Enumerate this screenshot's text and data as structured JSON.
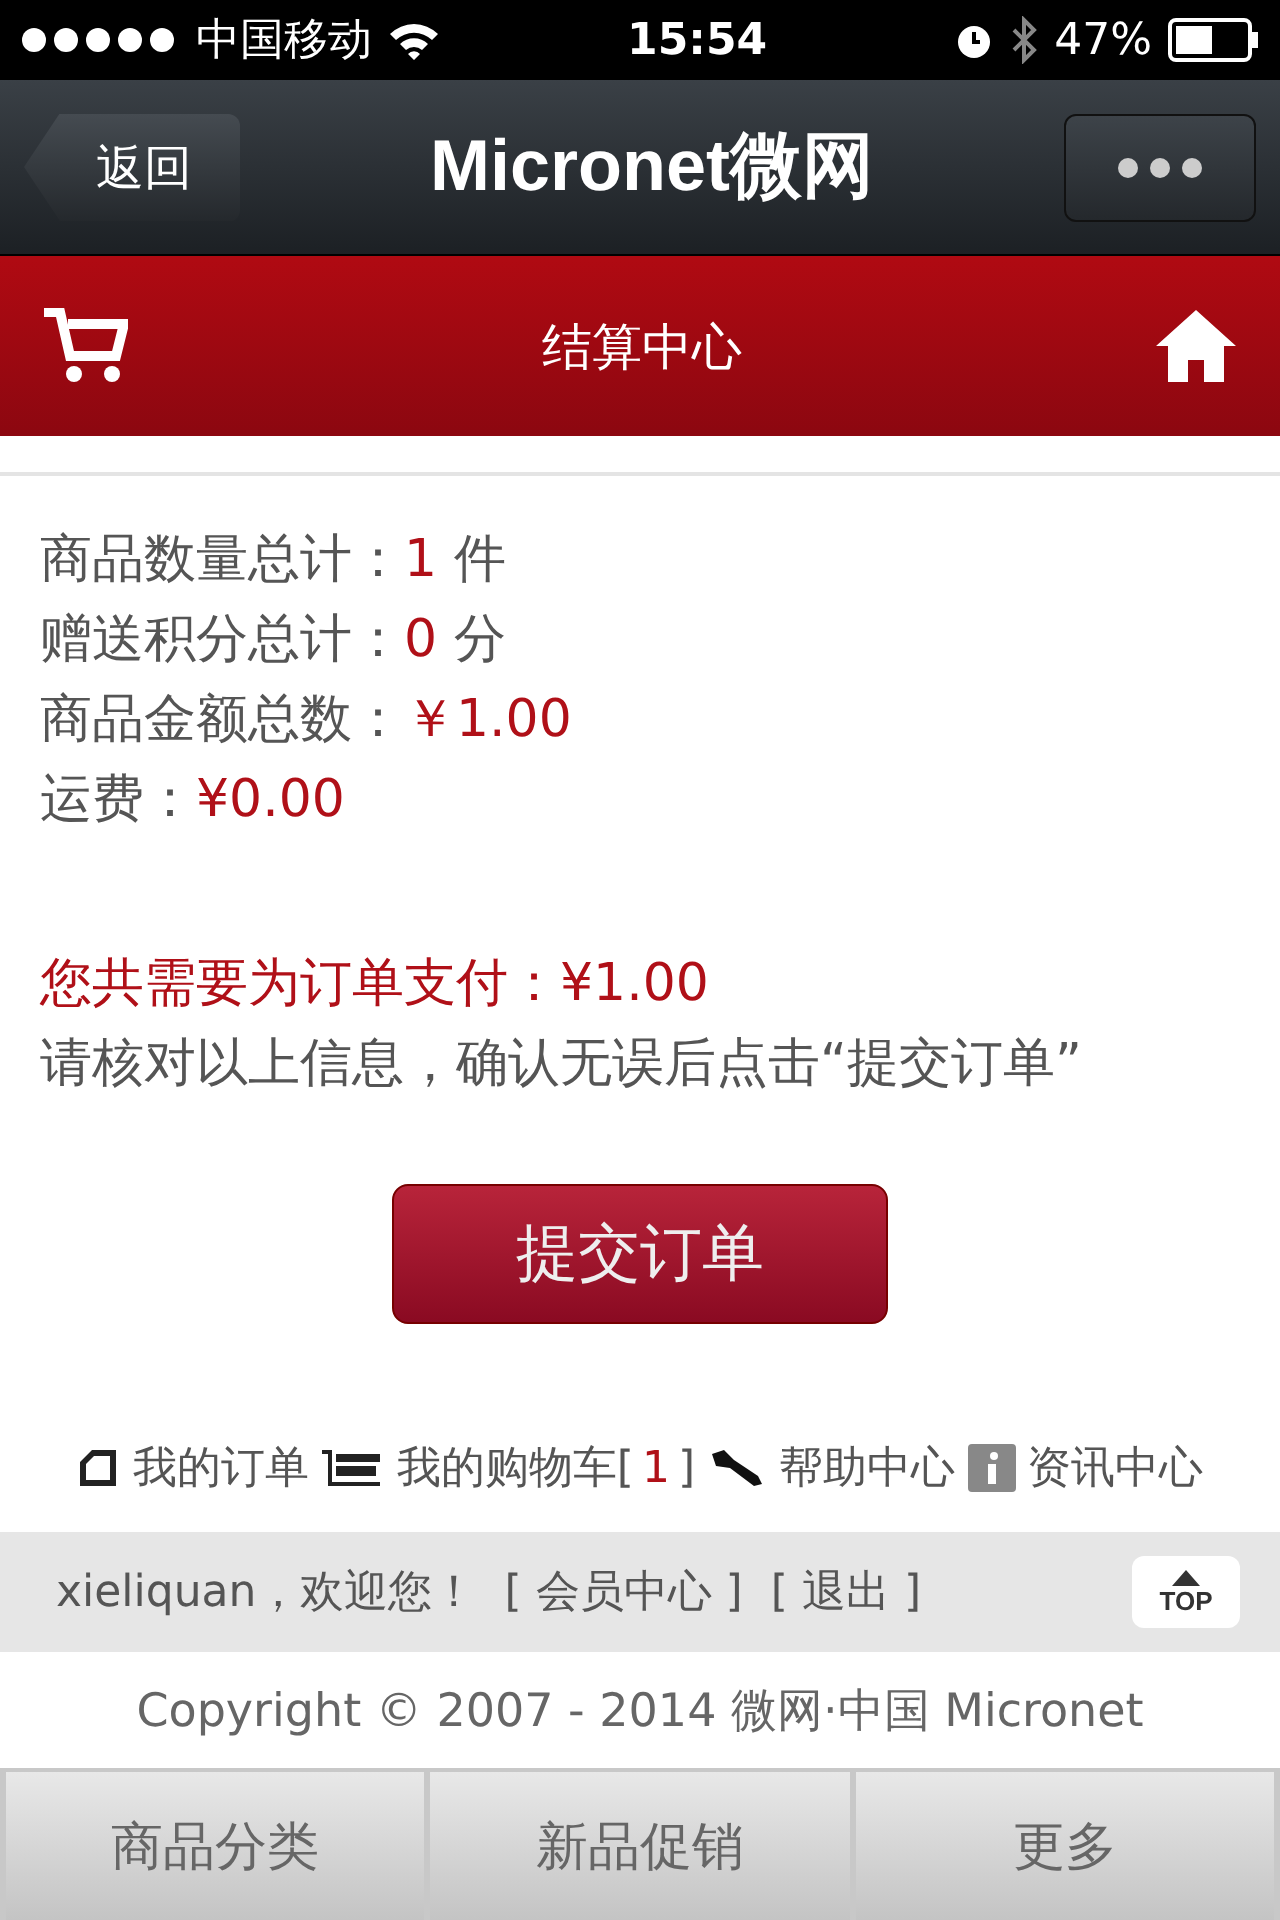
{
  "status_bar": {
    "carrier": "中国移动",
    "time": "15:54",
    "battery": "47%"
  },
  "nav_bar": {
    "back": "返回",
    "title": "Micronet微网"
  },
  "header": {
    "title": "结算中心"
  },
  "summary": [
    {
      "label": "商品数量总计：",
      "value": "1",
      "unit": "件"
    },
    {
      "label": "赠送积分总计：",
      "value": "0",
      "unit": "分"
    },
    {
      "label": "商品金额总数：",
      "value": "￥1.00"
    },
    {
      "label": "运费：",
      "value": "¥0.00"
    }
  ],
  "total": "您共需要为订单支付：¥1.00",
  "notice": "请核对以上信息，确认无误后点击“提交订单”",
  "submit": "提交订单",
  "links": [
    {
      "kind": "orders",
      "label": "我的订单"
    },
    {
      "kind": "cart",
      "label": "我的购物车",
      "open": "[",
      "count": "1",
      "close": "]"
    },
    {
      "kind": "help",
      "label": "帮助中心"
    },
    {
      "kind": "info",
      "label": "资讯中心"
    }
  ],
  "user_bar": {
    "welcome": "xieliquan，欢迎您！",
    "links": [
      "[ 会员中心 ]",
      "[ 退出 ]"
    ],
    "top": "TOP"
  },
  "copyright": "Copyright © 2007 - 2014 微网·中国 Micronet",
  "tab_bar": [
    "商品分类",
    "新品促销",
    "更多"
  ]
}
